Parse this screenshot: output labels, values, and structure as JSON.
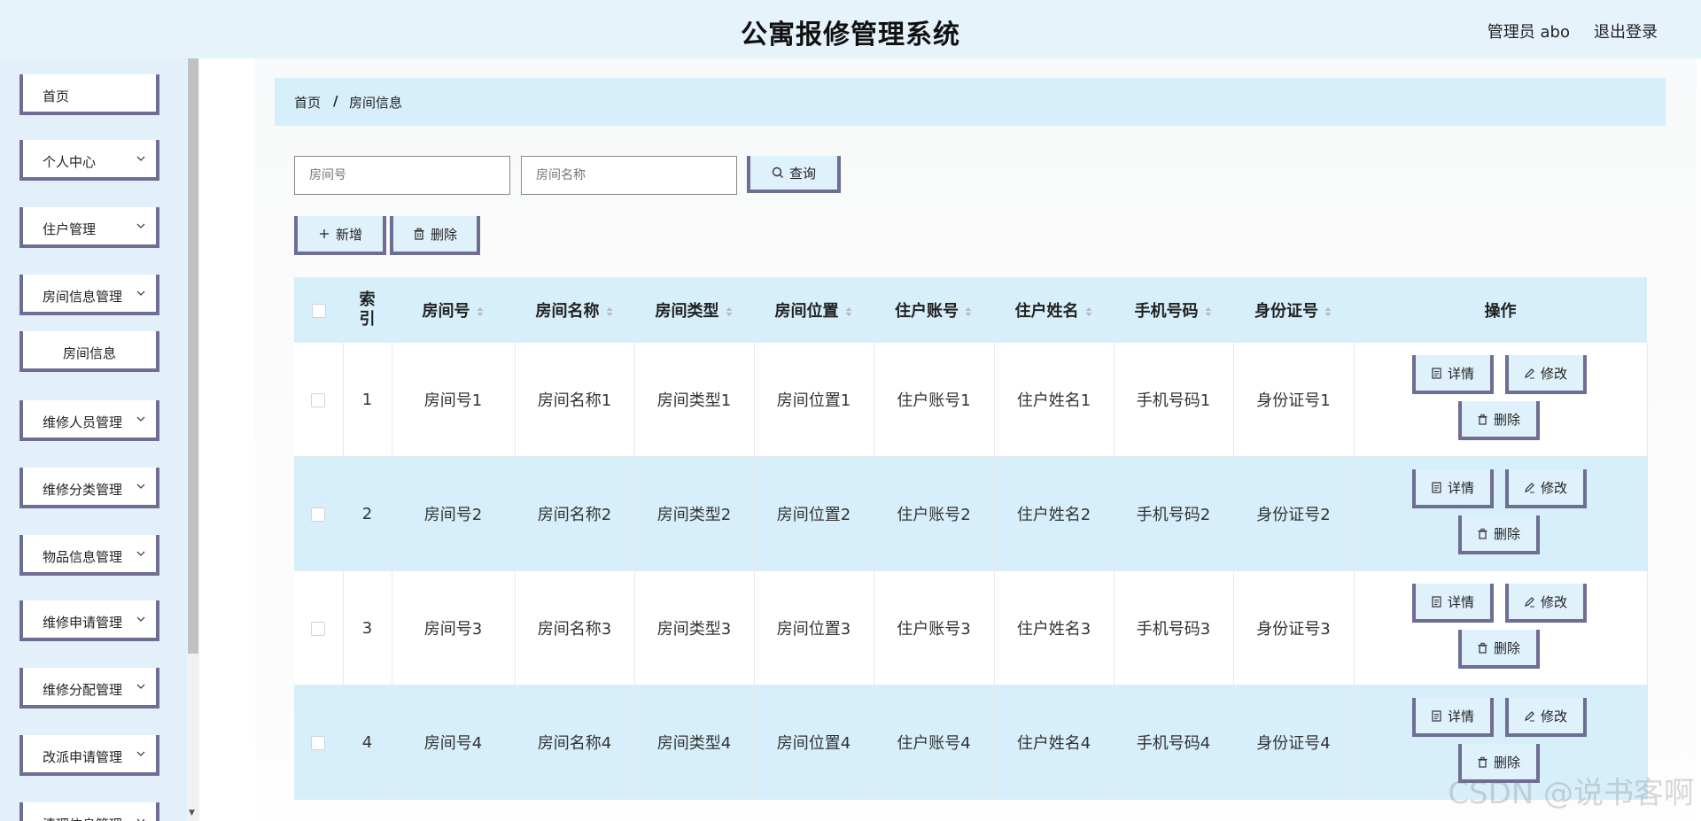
{
  "header": {
    "title": "公寓报修管理系统",
    "user": "管理员 abo",
    "logout": "退出登录"
  },
  "sidebar": {
    "items": [
      {
        "label": "首页",
        "expandable": false
      },
      {
        "label": "个人中心",
        "expandable": true
      },
      {
        "label": "住户管理",
        "expandable": true
      },
      {
        "label": "房间信息管理",
        "expandable": true
      },
      {
        "label": "房间信息",
        "expandable": false,
        "sub": true
      },
      {
        "label": "维修人员管理",
        "expandable": true
      },
      {
        "label": "维修分类管理",
        "expandable": true
      },
      {
        "label": "物品信息管理",
        "expandable": true
      },
      {
        "label": "维修申请管理",
        "expandable": true
      },
      {
        "label": "维修分配管理",
        "expandable": true
      },
      {
        "label": "改派申请管理",
        "expandable": true
      },
      {
        "label": "清理信息管理",
        "expandable": true
      }
    ]
  },
  "breadcrumb": {
    "home": "首页",
    "separator": "/",
    "current": "房间信息"
  },
  "search": {
    "room_no_placeholder": "房间号",
    "room_name_placeholder": "房间名称",
    "query_label": "查询"
  },
  "toolbar": {
    "add_label": "新增",
    "delete_label": "删除"
  },
  "table": {
    "headers": {
      "index": "索引",
      "room_no": "房间号",
      "room_name": "房间名称",
      "room_type": "房间类型",
      "room_location": "房间位置",
      "account": "住户账号",
      "name": "住户姓名",
      "phone": "手机号码",
      "id_card": "身份证号",
      "ops": "操作"
    },
    "ops": {
      "detail": "详情",
      "edit": "修改",
      "delete": "删除"
    },
    "rows": [
      {
        "index": "1",
        "room_no": "房间号1",
        "room_name": "房间名称1",
        "room_type": "房间类型1",
        "room_location": "房间位置1",
        "account": "住户账号1",
        "name": "住户姓名1",
        "phone": "手机号码1",
        "id_card": "身份证号1"
      },
      {
        "index": "2",
        "room_no": "房间号2",
        "room_name": "房间名称2",
        "room_type": "房间类型2",
        "room_location": "房间位置2",
        "account": "住户账号2",
        "name": "住户姓名2",
        "phone": "手机号码2",
        "id_card": "身份证号2"
      },
      {
        "index": "3",
        "room_no": "房间号3",
        "room_name": "房间名称3",
        "room_type": "房间类型3",
        "room_location": "房间位置3",
        "account": "住户账号3",
        "name": "住户姓名3",
        "phone": "手机号码3",
        "id_card": "身份证号3"
      },
      {
        "index": "4",
        "room_no": "房间号4",
        "room_name": "房间名称4",
        "room_type": "房间类型4",
        "room_location": "房间位置4",
        "account": "住户账号4",
        "name": "住户姓名4",
        "phone": "手机号码4",
        "id_card": "身份证号4"
      }
    ]
  },
  "watermark": "CSDN @说书客啊",
  "colors": {
    "header_bg": "#e6f3fb",
    "accent_border": "#6e6d94",
    "row_highlight": "#d7effa"
  }
}
